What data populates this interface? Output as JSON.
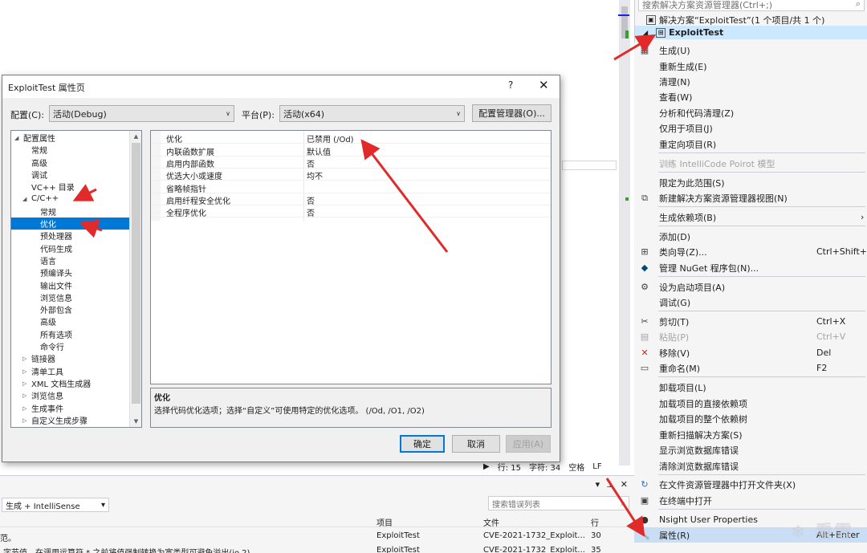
{
  "solution_explorer": {
    "search_placeholder": "搜索解决方案资源管理器(Ctrl+;)",
    "search_icon": "search-icon",
    "solution_label": "解决方案“ExploitTest”(1 个项目/共 1 个)",
    "project_label": "ExploitTest"
  },
  "context_menu": {
    "items": [
      {
        "label": "生成(U)",
        "icon": "build-icon"
      },
      {
        "label": "重新生成(E)"
      },
      {
        "label": "清理(N)"
      },
      {
        "label": "查看(W)"
      },
      {
        "label": "分析和代码清理(Z)"
      },
      {
        "label": "仅用于项目(J)"
      },
      {
        "label": "重定向项目(R)"
      },
      {
        "label": "训练 IntelliCode Poirot 模型"
      },
      {
        "label": "限定为此范围(S)"
      },
      {
        "label": "新建解决方案资源管理器视图(N)",
        "icon": "new-view-icon"
      },
      {
        "label": "生成依赖项(B)"
      },
      {
        "label": "添加(D)"
      },
      {
        "label": "类向导(Z)...",
        "shortcut": "Ctrl+Shift+X",
        "icon": "class-wizard-icon"
      },
      {
        "label": "管理 NuGet 程序包(N)...",
        "icon": "nuget-icon"
      },
      {
        "label": "设为启动项目(A)",
        "icon": "gear-icon"
      },
      {
        "label": "调试(G)"
      },
      {
        "label": "剪切(T)",
        "shortcut": "Ctrl+X",
        "icon": "scissors-icon"
      },
      {
        "label": "粘贴(P)",
        "shortcut": "Ctrl+V",
        "icon": "paste-icon"
      },
      {
        "label": "移除(V)",
        "shortcut": "Del",
        "icon": "remove-x-icon"
      },
      {
        "label": "重命名(M)",
        "shortcut": "F2",
        "icon": "rename-icon"
      },
      {
        "label": "卸载项目(L)"
      },
      {
        "label": "加载项目的直接依赖项"
      },
      {
        "label": "加载项目的整个依赖树"
      },
      {
        "label": "重新扫描解决方案(S)"
      },
      {
        "label": "显示浏览数据库错误"
      },
      {
        "label": "清除浏览数据库错误"
      },
      {
        "label": "在文件资源管理器中打开文件夹(X)",
        "icon": "open-folder-icon"
      },
      {
        "label": "在终端中打开",
        "icon": "terminal-icon"
      },
      {
        "label": "Nsight User Properties",
        "icon": "nsight-icon"
      },
      {
        "label": "属性(R)",
        "shortcut": "Alt+Enter",
        "icon": "wrench-icon"
      }
    ],
    "highlight_color": "#c9def5",
    "watermark": "看雪"
  },
  "dialog": {
    "title": "ExploitTest 属性页",
    "help": "?",
    "close": "✕",
    "config_label": "配置(C):",
    "config_value": "活动(Debug)",
    "platform_label": "平台(P):",
    "platform_value": "活动(x64)",
    "config_manager": "配置管理器(O)...",
    "tree": [
      {
        "label": "配置属性",
        "toggle": "◢"
      },
      {
        "label": "常规"
      },
      {
        "label": "高级"
      },
      {
        "label": "调试"
      },
      {
        "label": "VC++ 目录"
      },
      {
        "label": "C/C++",
        "toggle": "◢"
      },
      {
        "label": "常规"
      },
      {
        "label": "优化"
      },
      {
        "label": "预处理器"
      },
      {
        "label": "代码生成"
      },
      {
        "label": "语言"
      },
      {
        "label": "预编译头"
      },
      {
        "label": "输出文件"
      },
      {
        "label": "浏览信息"
      },
      {
        "label": "外部包含"
      },
      {
        "label": "高级"
      },
      {
        "label": "所有选项"
      },
      {
        "label": "命令行"
      },
      {
        "label": "链接器",
        "toggle": "▷"
      },
      {
        "label": "清单工具",
        "toggle": "▷"
      },
      {
        "label": "XML 文档生成器",
        "toggle": "▷"
      },
      {
        "label": "浏览信息",
        "toggle": "▷"
      },
      {
        "label": "生成事件",
        "toggle": "▷"
      },
      {
        "label": "自定义生成步骤",
        "toggle": "▷"
      }
    ],
    "properties": [
      {
        "name": "优化",
        "value": "已禁用 (/Od)"
      },
      {
        "name": "内联函数扩展",
        "value": "默认值"
      },
      {
        "name": "启用内部函数",
        "value": "否"
      },
      {
        "name": "优选大小或速度",
        "value": "均不"
      },
      {
        "name": "省略帧指针",
        "value": ""
      },
      {
        "name": "启用纤程安全优化",
        "value": "否"
      },
      {
        "name": "全程序优化",
        "value": "否"
      }
    ],
    "description_title": "优化",
    "description_text": "选择代码优化选项；选择“自定义”可使用特定的优化选项。     (/Od, /O1, /O2)",
    "ok": "确定",
    "cancel": "取消",
    "apply": "应用(A)"
  },
  "status_bar": {
    "line": "行: 15",
    "char": "字符: 34",
    "space": "空格",
    "eol": "LF"
  },
  "error_list": {
    "filter_value": "生成 + IntelliSense",
    "search_placeholder": "搜索错误列表",
    "columns": [
      "项目",
      "文件",
      "行"
    ],
    "rows": [
      {
        "desc": "范。",
        "project": "ExploitTest",
        "file": "CVE-2021-1732_Exploit...",
        "line": "30"
      },
      {
        "desc": "字节值。在调用运算符 * 之前将值强制转换为宽类型可避免溢出(io.2)。",
        "project": "ExploitTest",
        "file": "CVE-2021-1732_Exploit...",
        "line": "35"
      }
    ]
  }
}
